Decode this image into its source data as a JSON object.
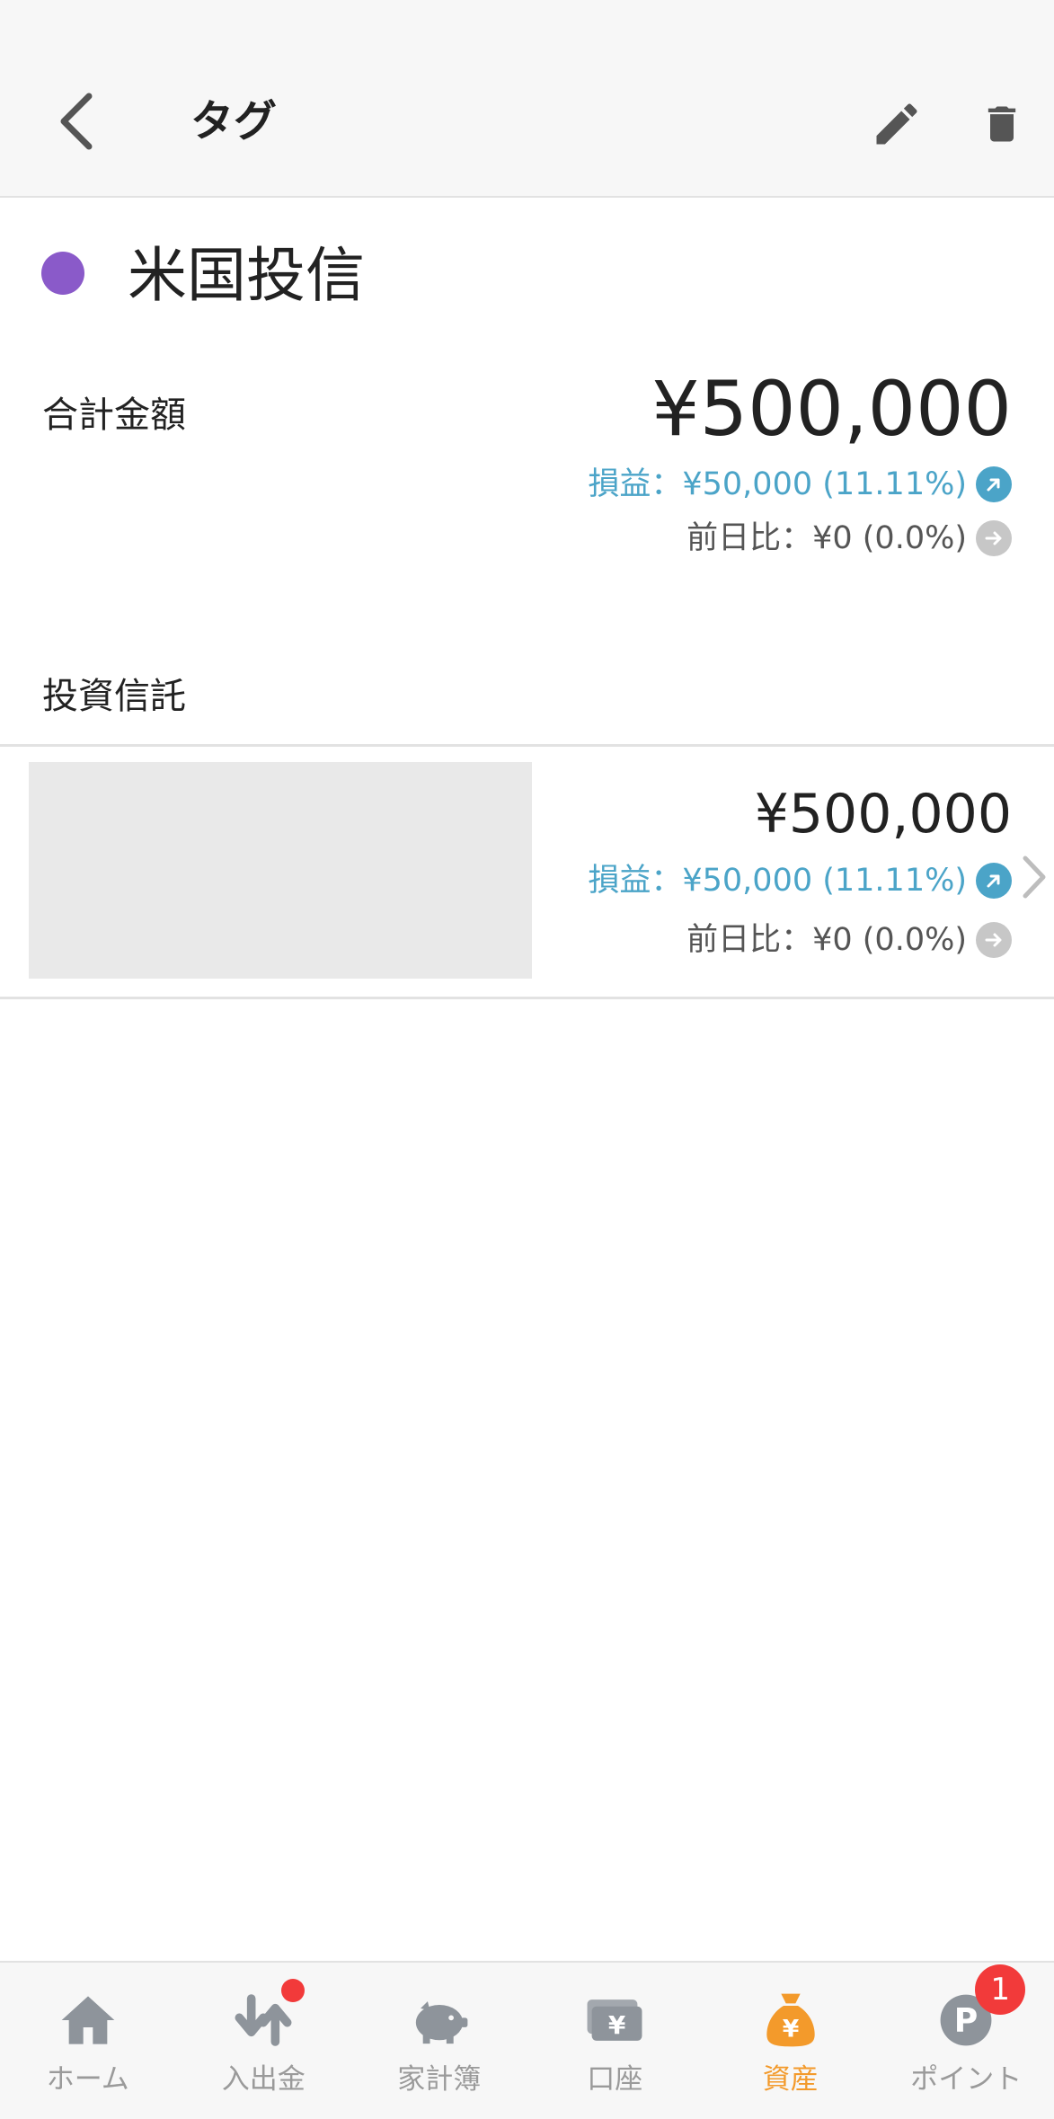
{
  "header": {
    "title": "タグ",
    "back_icon": "chevron-left-icon",
    "edit_icon": "pencil-icon",
    "delete_icon": "trash-icon"
  },
  "tag": {
    "name": "米国投信",
    "color": "#8a5ac9"
  },
  "summary": {
    "total_label": "合計金額",
    "total_amount": "¥500,000",
    "profit_loss": "損益：¥50,000 (11.11%)",
    "day_change": "前日比：¥0 (0.0%)"
  },
  "section": {
    "label": "投資信託"
  },
  "fund": {
    "amount": "¥500,000",
    "profit_loss": "損益：¥50,000 (11.11%)",
    "day_change": "前日比：¥0 (0.0%)"
  },
  "colors": {
    "accent_blue": "#4ba4c8",
    "neutral_gray": "#c7c7c7",
    "active_orange": "#f39a2b",
    "badge_red": "#f23a3a"
  },
  "tabs": [
    {
      "label": "ホーム",
      "icon": "home-icon"
    },
    {
      "label": "入出金",
      "icon": "transfer-arrows-icon"
    },
    {
      "label": "家計簿",
      "icon": "piggy-bank-icon"
    },
    {
      "label": "口座",
      "icon": "wallet-yen-icon"
    },
    {
      "label": "資産",
      "icon": "money-bag-yen-icon"
    },
    {
      "label": "ポイント",
      "icon": "point-p-icon",
      "badge": "1"
    }
  ]
}
